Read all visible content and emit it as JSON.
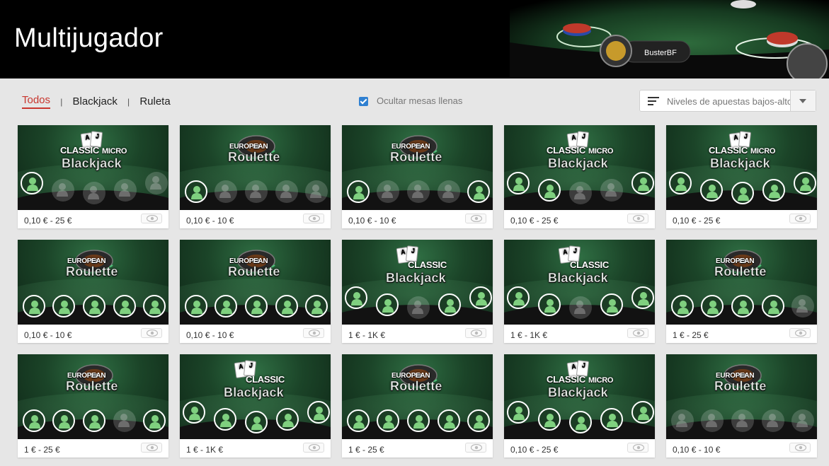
{
  "header": {
    "title": "Multijugador",
    "banner_player": "BusterBF"
  },
  "filters": {
    "tabs": [
      {
        "label": "Todos",
        "active": true
      },
      {
        "label": "Blackjack",
        "active": false
      },
      {
        "label": "Ruleta",
        "active": false
      }
    ],
    "hide_full_label": "Ocultar mesas llenas",
    "hide_full_checked": true,
    "sort_label": "Niveles de apuestas bajos-altos"
  },
  "colors": {
    "accent": "#c8362e",
    "checkbox": "#2f80d1",
    "seat_icon": "#7fd07f"
  },
  "tables": [
    {
      "game": "classic-micro-blackjack",
      "logo_top": "CLASSIC",
      "logo_micro": "MICRO",
      "logo_main": "Blackjack",
      "stake": "0,10 € - 25 €",
      "seats": [
        "free",
        "taken",
        "taken",
        "taken",
        "taken"
      ]
    },
    {
      "game": "european-roulette",
      "logo_top": "EUROPEAN",
      "logo_micro": "",
      "logo_main": "Roulette",
      "stake": "0,10 € - 10 €",
      "seats": [
        "free",
        "taken",
        "taken",
        "taken",
        "taken"
      ]
    },
    {
      "game": "european-roulette",
      "logo_top": "EUROPEAN",
      "logo_micro": "",
      "logo_main": "Roulette",
      "stake": "0,10 € - 10 €",
      "seats": [
        "free",
        "taken",
        "taken",
        "taken",
        "free"
      ]
    },
    {
      "game": "classic-micro-blackjack",
      "logo_top": "CLASSIC",
      "logo_micro": "MICRO",
      "logo_main": "Blackjack",
      "stake": "0,10 € - 25 €",
      "seats": [
        "free",
        "free",
        "taken",
        "taken",
        "free"
      ]
    },
    {
      "game": "classic-micro-blackjack",
      "logo_top": "CLASSIC",
      "logo_micro": "MICRO",
      "logo_main": "Blackjack",
      "stake": "0,10 € - 25 €",
      "seats": [
        "free",
        "free",
        "free",
        "free",
        "free"
      ]
    },
    {
      "game": "european-roulette",
      "logo_top": "EUROPEAN",
      "logo_micro": "",
      "logo_main": "Roulette",
      "stake": "0,10 € - 10 €",
      "seats": [
        "free",
        "free",
        "free",
        "free",
        "free"
      ]
    },
    {
      "game": "european-roulette",
      "logo_top": "EUROPEAN",
      "logo_micro": "",
      "logo_main": "Roulette",
      "stake": "0,10 € - 10 €",
      "seats": [
        "free",
        "free",
        "free",
        "free",
        "free"
      ]
    },
    {
      "game": "classic-blackjack",
      "logo_top": "CLASSIC",
      "logo_micro": "",
      "logo_main": "Blackjack",
      "stake": "1 € - 1K €",
      "seats": [
        "free",
        "free",
        "taken",
        "free",
        "free"
      ]
    },
    {
      "game": "classic-blackjack",
      "logo_top": "CLASSIC",
      "logo_micro": "",
      "logo_main": "Blackjack",
      "stake": "1 € - 1K €",
      "seats": [
        "free",
        "free",
        "taken",
        "free",
        "free"
      ]
    },
    {
      "game": "european-roulette",
      "logo_top": "EUROPEAN",
      "logo_micro": "",
      "logo_main": "Roulette",
      "stake": "1 € - 25 €",
      "seats": [
        "free",
        "free",
        "free",
        "free",
        "taken"
      ]
    },
    {
      "game": "european-roulette",
      "logo_top": "EUROPEAN",
      "logo_micro": "",
      "logo_main": "Roulette",
      "stake": "1 € - 25 €",
      "seats": [
        "free",
        "free",
        "free",
        "taken",
        "free"
      ]
    },
    {
      "game": "classic-blackjack",
      "logo_top": "CLASSIC",
      "logo_micro": "",
      "logo_main": "Blackjack",
      "stake": "1 € - 1K €",
      "seats": [
        "free",
        "free",
        "free",
        "free",
        "free"
      ]
    },
    {
      "game": "european-roulette",
      "logo_top": "EUROPEAN",
      "logo_micro": "",
      "logo_main": "Roulette",
      "stake": "1 € - 25 €",
      "seats": [
        "free",
        "free",
        "free",
        "free",
        "free"
      ]
    },
    {
      "game": "classic-micro-blackjack",
      "logo_top": "CLASSIC",
      "logo_micro": "MICRO",
      "logo_main": "Blackjack",
      "stake": "0,10 € - 25 €",
      "seats": [
        "free",
        "free",
        "free",
        "free",
        "free"
      ]
    },
    {
      "game": "european-roulette",
      "logo_top": "EUROPEAN",
      "logo_micro": "",
      "logo_main": "Roulette",
      "stake": "0,10 € - 10 €",
      "seats": [
        "taken",
        "taken",
        "taken",
        "taken",
        "taken"
      ]
    }
  ]
}
